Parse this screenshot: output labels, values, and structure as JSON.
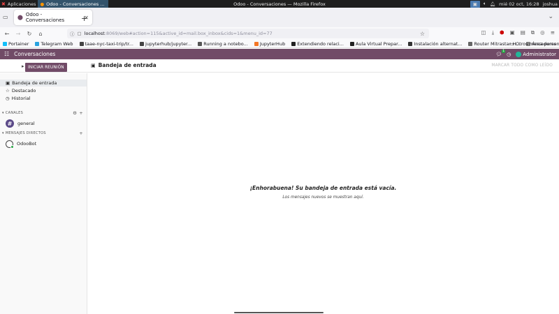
{
  "os": {
    "apps_label": "Aplicaciones",
    "task_label": "Odoo - Conversaciones ...",
    "window_title": "Odoo - Conversaciones — Mozilla Firefox",
    "clock": "mié 02 oct, 16:28",
    "user": "joshua"
  },
  "browser": {
    "tab_title": "Odoo - Conversaciones",
    "url_host": "localhost",
    "url_rest": ":8069/web#action=115&active_id=mail.box_inbox&cids=1&menu_id=77",
    "bookmarks": [
      {
        "label": "Portainer",
        "color": "#13bef9"
      },
      {
        "label": "Telegram Web",
        "color": "#2aa3df"
      },
      {
        "label": "taae-nyc-taxi-trip/tr...",
        "color": "#444444"
      },
      {
        "label": "jupyterhub/jupyter...",
        "color": "#444444"
      },
      {
        "label": "Running a notebo...",
        "color": "#555555"
      },
      {
        "label": "JupyterHub",
        "color": "#f37626"
      },
      {
        "label": "Extendiendo relaci...",
        "color": "#222222"
      },
      {
        "label": "Aula Virtual Prepar...",
        "color": "#222222"
      },
      {
        "label": "Instalación alternat...",
        "color": "#333333"
      },
      {
        "label": "Router Mitrastar H...",
        "color": "#666666"
      },
      {
        "label": "Área personal",
        "color": "#888888"
      }
    ],
    "other_bookmarks": "Otros marcadores"
  },
  "odoo": {
    "app_name": "Conversaciones",
    "user_name": "Administrator",
    "messages_badge": "1",
    "start_meeting": "INICIAR REUNIÓN",
    "inbox_title": "Bandeja de entrada",
    "mark_all_read": "MARCAR TODO COMO LEÍDO",
    "sidebar": {
      "mailboxes": [
        {
          "label": "Bandeja de entrada",
          "icon": "inbox-icon"
        },
        {
          "label": "Destacado",
          "icon": "star-icon"
        },
        {
          "label": "Historial",
          "icon": "history-icon"
        }
      ],
      "channels_header": "CANALES",
      "channels": [
        {
          "label": "general"
        }
      ],
      "dm_header": "MENSAJES DIRECTOS",
      "direct_messages": [
        {
          "label": "OdooBot"
        }
      ]
    },
    "empty": {
      "title": "¡Enhorabuena! Su bandeja de entrada está vacía.",
      "subtitle": "Los mensajes nuevos se muestran aquí."
    }
  },
  "colors": {
    "brand": "#714b67",
    "online": "#28a745"
  }
}
